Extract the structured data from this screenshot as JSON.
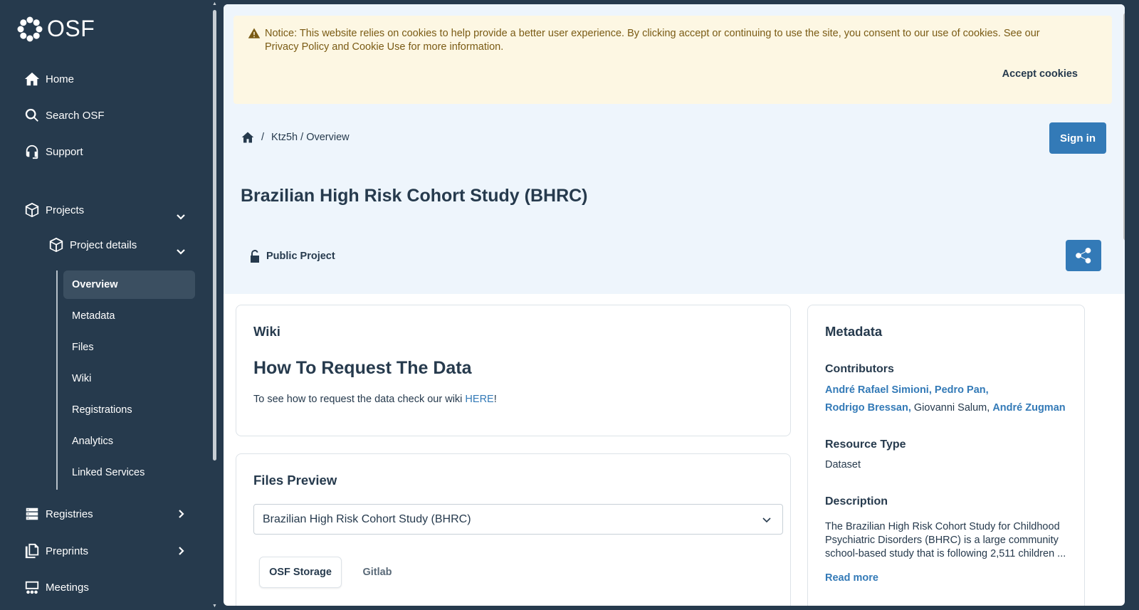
{
  "app": {
    "logo_text": "OSF"
  },
  "sidebar": {
    "main_items": [
      {
        "label": "Home",
        "icon": "home-icon"
      },
      {
        "label": "Search OSF",
        "icon": "search-icon"
      },
      {
        "label": "Support",
        "icon": "headset-icon"
      }
    ],
    "projects_label": "Projects",
    "project_details_label": "Project details",
    "sub_items": [
      "Overview",
      "Metadata",
      "Files",
      "Wiki",
      "Registrations",
      "Analytics",
      "Linked Services"
    ],
    "active_sub_item": "Overview",
    "registries_label": "Registries",
    "preprints_label": "Preprints",
    "meetings_label": "Meetings"
  },
  "cookie_banner": {
    "text": "Notice: This website relies on cookies to help provide a better user experience. By clicking accept or continuing to use the site, you consent to our use of cookies. See our Privacy Policy and Cookie Use for more information.",
    "accept_label": "Accept cookies"
  },
  "header": {
    "breadcrumb_separator": "/",
    "breadcrumb_path": "Ktz5h / Overview",
    "sign_in_label": "Sign in",
    "project_title": "Brazilian High Risk Cohort Study (BHRC)",
    "visibility_label": "Public Project"
  },
  "wiki": {
    "heading": "Wiki",
    "title": "How To Request The Data",
    "text_before": "To see how to request the data check our wiki ",
    "link_text": "HERE",
    "text_after": "!"
  },
  "files_preview": {
    "heading": "Files Preview",
    "selected_project": "Brazilian High Risk Cohort Study (BHRC)",
    "tabs": [
      "OSF Storage",
      "Gitlab"
    ],
    "active_tab": "OSF Storage"
  },
  "metadata": {
    "heading": "Metadata",
    "contributors_label": "Contributors",
    "contributors": [
      {
        "name": "André Rafael Simioni,",
        "linked": true
      },
      {
        "name": "Pedro Pan,",
        "linked": true
      },
      {
        "name": "Rodrigo Bressan,",
        "linked": true
      },
      {
        "name": "Giovanni Salum,",
        "linked": false
      },
      {
        "name": "André Zugman",
        "linked": true
      }
    ],
    "resource_type_label": "Resource Type",
    "resource_type": "Dataset",
    "description_label": "Description",
    "description": "The Brazilian High Risk Cohort Study for Childhood Psychiatric Disorders (BHRC) is a large community school-based study that is following 2,511 children ...",
    "read_more_label": "Read more"
  },
  "colors": {
    "sidebar_bg": "#263a4d",
    "accent": "#337ab7",
    "hero_bg": "#eef5fc",
    "cookie_bg": "#fdf7e3"
  }
}
